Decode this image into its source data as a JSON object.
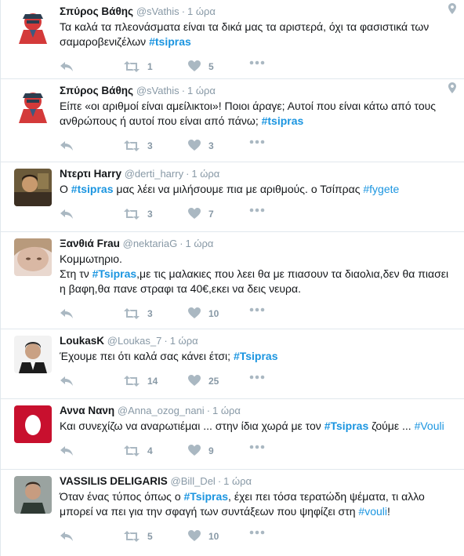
{
  "tweets": [
    {
      "name": "Σπύρος Βάθης",
      "handle": "@sVathis",
      "time": "1 ώρα",
      "text": [
        {
          "t": "Τα καλά τα πλεονάσματα είναι τα δικά μας τα αριστερά, όχι τα φασιστικά των σαμαροβενιζέλων "
        },
        {
          "t": "#tsipras",
          "tag": true
        }
      ],
      "retweets": "1",
      "likes": "5",
      "geo": true
    },
    {
      "name": "Σπύρος Βάθης",
      "handle": "@sVathis",
      "time": "1 ώρα",
      "text": [
        {
          "t": "Είπε «οι αριθμοί είναι αμείλικτοι»! Ποιοι άραγε; Αυτοί που είναι κάτω από τους ανθρώπους ή αυτοί που είναι από πάνω; "
        },
        {
          "t": "#tsipras",
          "tag": true
        }
      ],
      "retweets": "3",
      "likes": "3",
      "geo": true
    },
    {
      "name": "Ντερτι Harry",
      "handle": "@derti_harry",
      "time": "1 ώρα",
      "text": [
        {
          "t": "Ο "
        },
        {
          "t": "#tsipras",
          "tag": true
        },
        {
          "t": " μας λέει να μιλήσουμε πια με αριθμούς. ο Τσίπρας "
        },
        {
          "t": "#fygete",
          "tag": true,
          "plain": true
        }
      ],
      "retweets": "3",
      "likes": "7",
      "geo": false
    },
    {
      "name": "Ξανθιά Frau",
      "handle": "@nektariaG",
      "time": "1 ώρα",
      "text": [
        {
          "t": "Κομμωτηριο.\nΣτη τν "
        },
        {
          "t": "#Tsipras",
          "tag": true
        },
        {
          "t": ",με τις μαλακιες που λεει θα με πιασουν τα διαολια,δεν θα πιασει η βαφη,θα πανε στραφι τα 40€,εκει να δεις νευρα."
        }
      ],
      "retweets": "3",
      "likes": "10",
      "geo": false
    },
    {
      "name": "LoukasK",
      "handle": "@Loukas_7",
      "time": "1 ώρα",
      "text": [
        {
          "t": "Έχουμε πει ότι καλά σας κάνει έτσι; "
        },
        {
          "t": "#Tsipras",
          "tag": true
        }
      ],
      "retweets": "14",
      "likes": "25",
      "geo": false
    },
    {
      "name": "Αννα Νανη",
      "handle": "@Anna_ozog_nani",
      "time": "1 ώρα",
      "text": [
        {
          "t": "Και συνεχίζω να αναρωτιέμαι ... στην ίδια χωρά με τον "
        },
        {
          "t": "#Tsipras",
          "tag": true
        },
        {
          "t": " ζούμε ... "
        },
        {
          "t": "#Vouli",
          "tag": true,
          "plain": true
        }
      ],
      "retweets": "4",
      "likes": "9",
      "geo": false
    },
    {
      "name": "VASSILIS DELIGARIS",
      "handle": "@Bill_Del",
      "time": "1 ώρα",
      "text": [
        {
          "t": "Όταν ένας τύπος όπως ο "
        },
        {
          "t": "#Tsipras",
          "tag": true
        },
        {
          "t": ", έχει πει τόσα τερατώδη ψέματα, τι αλλο μπορεί να πει για την σφαγή των συντάξεων που ψηφίζει στη "
        },
        {
          "t": "#vouli",
          "tag": true,
          "plain": true
        },
        {
          "t": "!"
        }
      ],
      "retweets": "5",
      "likes": "10",
      "geo": false
    }
  ]
}
